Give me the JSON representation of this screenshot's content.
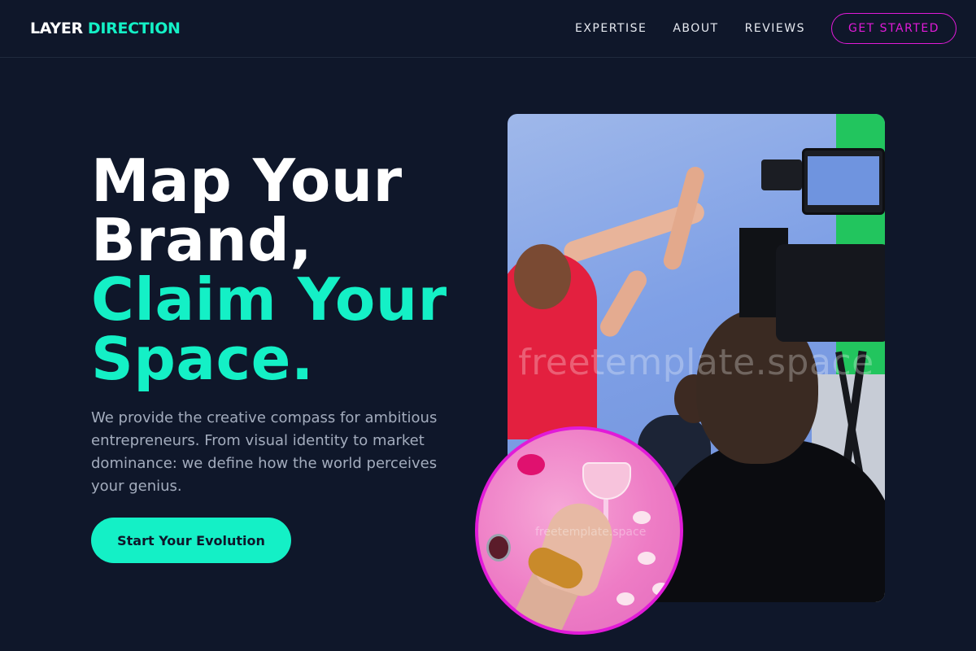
{
  "nav": {
    "logo_primary": "LAYER",
    "logo_accent": "DIRECTION",
    "links": [
      "EXPERTISE",
      "ABOUT",
      "REVIEWS"
    ],
    "cta_label": "GET STARTED"
  },
  "hero": {
    "headline_line1": "Map Your",
    "headline_line2": "Brand,",
    "headline_line3": "Claim Your",
    "headline_line4": "Space.",
    "description": "We provide the creative compass for ambitious entrepreneurs. From visual identity to market dominance: we define how the world perceives your genius.",
    "cta_label": "Start Your Evolution",
    "watermark": "freetemplate.space",
    "circle_watermark": "freetemplate.space"
  },
  "colors": {
    "background": "#0f172a",
    "accent": "#14f0c6",
    "magenta": "#e11bd8"
  }
}
